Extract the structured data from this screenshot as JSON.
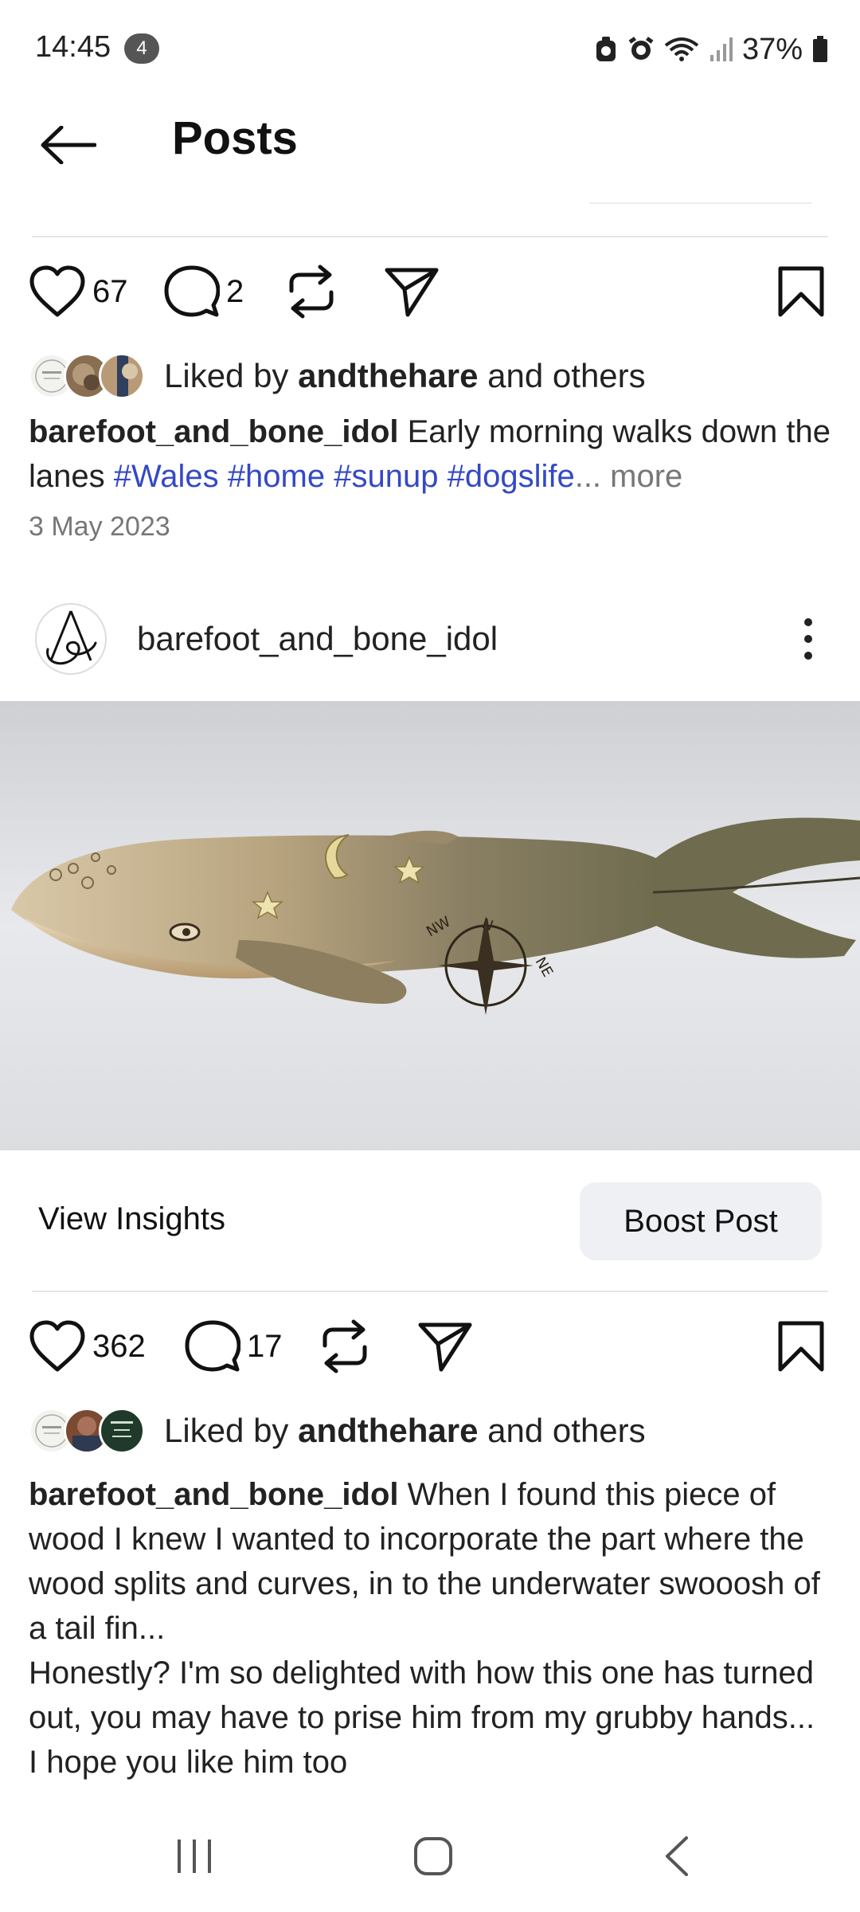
{
  "status_bar": {
    "time": "14:45",
    "notification_count": "4",
    "battery": "37%",
    "icons": [
      "silent-mode-icon",
      "alarm-icon",
      "wifi-icon",
      "signal-icon",
      "battery-icon"
    ]
  },
  "header": {
    "title": "Posts",
    "back_icon": "arrow-left-icon"
  },
  "post1": {
    "likes": "67",
    "comments": "2",
    "liked_by_prefix": "Liked by ",
    "liked_by_user": "andthehare",
    "liked_by_suffix": " and others",
    "username": "barefoot_and_bone_idol",
    "caption_text": " Early morning walks down the lanes ",
    "hashtags": [
      "#Wales",
      "#home",
      "#sunup",
      "#dogslife"
    ],
    "ellipsis": "...",
    "more": " more",
    "date": "3 May 2023"
  },
  "post2": {
    "username": "barefoot_and_bone_idol",
    "view_insights": "View Insights",
    "boost_post": "Boost Post",
    "likes": "362",
    "comments": "17",
    "liked_by_prefix": "Liked by ",
    "liked_by_user": "andthehare",
    "liked_by_suffix": " and others",
    "caption_username": "barefoot_and_bone_idol",
    "caption_line1": " When I found this piece of wood I knew I wanted to incorporate the part where the wood splits and curves, in to the underwater swooosh of a tail fin...",
    "caption_line2": "Honestly? I'm so delighted with how this one has turned out, you may have to prise him from my grubby hands...",
    "caption_line3": "I hope you like him too"
  },
  "nav_bar": {
    "icons": [
      "recent-apps-icon",
      "home-icon",
      "back-icon"
    ]
  },
  "colors": {
    "hashtag": "#3449c4",
    "boost_bg": "#eff0f4",
    "muted": "#777777"
  }
}
